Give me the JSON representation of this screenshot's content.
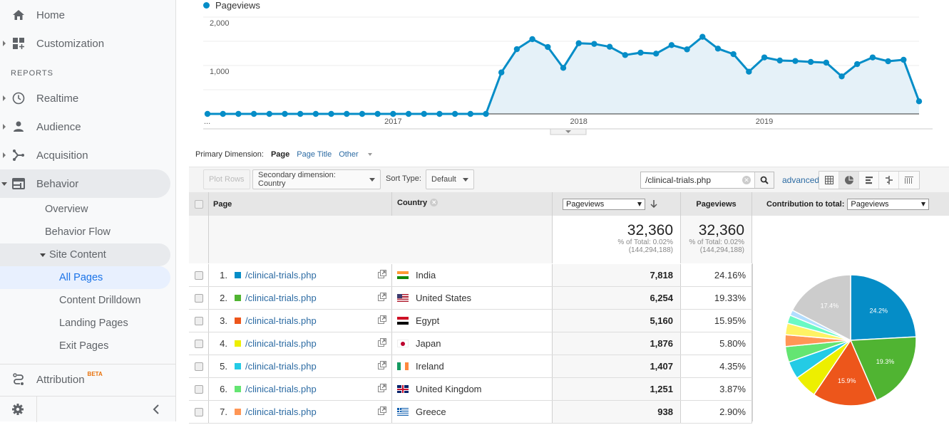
{
  "sidebar": {
    "home": "Home",
    "customization": "Customization",
    "reports_label": "REPORTS",
    "realtime": "Realtime",
    "audience": "Audience",
    "acquisition": "Acquisition",
    "behavior": "Behavior",
    "behavior_children": {
      "overview": "Overview",
      "behavior_flow": "Behavior Flow",
      "site_content": "Site Content",
      "all_pages": "All Pages",
      "content_drilldown": "Content Drilldown",
      "landing_pages": "Landing Pages",
      "exit_pages": "Exit Pages"
    },
    "attribution": "Attribution",
    "attribution_badge": "BETA"
  },
  "chart_data": {
    "type": "line",
    "title": "",
    "legend": [
      "Pageviews"
    ],
    "series_color": "#058dc7",
    "y_ticks": [
      "1,000",
      "2,000"
    ],
    "x_ticks": [
      "...",
      "2017",
      "2018",
      "2019"
    ],
    "ylim": [
      0,
      2000
    ],
    "grid": true,
    "series": [
      {
        "name": "Pageviews",
        "values": [
          0,
          0,
          0,
          0,
          0,
          0,
          0,
          0,
          0,
          0,
          0,
          0,
          0,
          0,
          0,
          0,
          0,
          0,
          0,
          857,
          1338,
          1544,
          1382,
          951,
          1460,
          1446,
          1387,
          1216,
          1265,
          1245,
          1422,
          1333,
          1593,
          1348,
          1235,
          872,
          1167,
          1103,
          1093,
          1074,
          1059,
          775,
          1029,
          1167,
          1088,
          1118,
          260
        ]
      }
    ],
    "x_tick_index": {
      "...": 0,
      "2017": 12,
      "2018": 24,
      "2019": 36
    }
  },
  "primary_dimension": {
    "label": "Primary Dimension:",
    "current": "Page",
    "options": [
      "Page Title",
      "Other"
    ]
  },
  "toolbar": {
    "plot_rows": "Plot Rows",
    "secondary_dimension": "Secondary dimension: Country",
    "sort_type_label": "Sort Type:",
    "sort_type_value": "Default",
    "search_value": "/clinical-trials.php",
    "advanced": "advanced"
  },
  "table": {
    "headers": {
      "page": "Page",
      "country": "Country",
      "metric_select": "Pageviews",
      "pageviews": "Pageviews",
      "contribution_label": "Contribution to total:",
      "contribution_select": "Pageviews"
    },
    "totals": {
      "value1": "32,360",
      "pct1": "% of Total: 0.02%",
      "abs1": "(144,294,188)",
      "value2": "32,360",
      "pct2": "% of Total: 0.02%",
      "abs2": "(144,294,188)"
    },
    "rows": [
      {
        "idx": "1.",
        "page": "/clinical-trials.php",
        "color": "#058dc7",
        "country": "India",
        "flag": "india",
        "pageviews": "7,818",
        "pct": "24.16%"
      },
      {
        "idx": "2.",
        "page": "/clinical-trials.php",
        "color": "#50b432",
        "country": "United States",
        "flag": "us",
        "pageviews": "6,254",
        "pct": "19.33%"
      },
      {
        "idx": "3.",
        "page": "/clinical-trials.php",
        "color": "#ed561b",
        "country": "Egypt",
        "flag": "egypt",
        "pageviews": "5,160",
        "pct": "15.95%"
      },
      {
        "idx": "4.",
        "page": "/clinical-trials.php",
        "color": "#edef00",
        "country": "Japan",
        "flag": "japan",
        "pageviews": "1,876",
        "pct": "5.80%"
      },
      {
        "idx": "5.",
        "page": "/clinical-trials.php",
        "color": "#24cbe5",
        "country": "Ireland",
        "flag": "ireland",
        "pageviews": "1,407",
        "pct": "4.35%"
      },
      {
        "idx": "6.",
        "page": "/clinical-trials.php",
        "color": "#64e572",
        "country": "United Kingdom",
        "flag": "uk",
        "pageviews": "1,251",
        "pct": "3.87%"
      },
      {
        "idx": "7.",
        "page": "/clinical-trials.php",
        "color": "#ff9655",
        "country": "Greece",
        "flag": "greece",
        "pageviews": "938",
        "pct": "2.90%"
      }
    ]
  },
  "pie": {
    "slices": [
      {
        "value": 24.16,
        "color": "#058dc7",
        "label": "24.2%"
      },
      {
        "value": 19.33,
        "color": "#50b432",
        "label": "19.3%"
      },
      {
        "value": 15.95,
        "color": "#ed561b",
        "label": "15.9%"
      },
      {
        "value": 5.8,
        "color": "#edef00",
        "label": ""
      },
      {
        "value": 4.35,
        "color": "#24cbe5",
        "label": ""
      },
      {
        "value": 3.87,
        "color": "#64e572",
        "label": ""
      },
      {
        "value": 2.9,
        "color": "#ff9655",
        "label": ""
      },
      {
        "value": 2.85,
        "color": "#fff263",
        "label": ""
      },
      {
        "value": 2.05,
        "color": "#6af9c4",
        "label": ""
      },
      {
        "value": 1.34,
        "color": "#b2deff",
        "label": ""
      },
      {
        "value": 17.4,
        "color": "#cccccc",
        "label": "17.4%"
      }
    ]
  }
}
